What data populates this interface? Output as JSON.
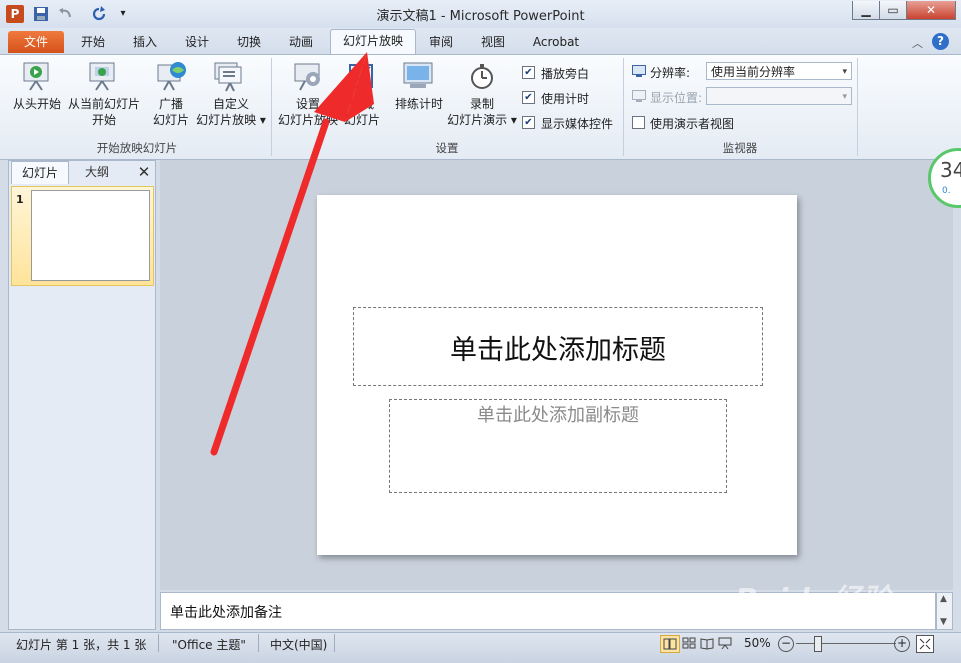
{
  "window": {
    "title": "演示文稿1 - Microsoft PowerPoint"
  },
  "tabs": [
    "文件",
    "开始",
    "插入",
    "设计",
    "切换",
    "动画",
    "幻灯片放映",
    "审阅",
    "视图",
    "Acrobat"
  ],
  "ribbon": {
    "groups": [
      {
        "label": "开始放映幻灯片",
        "buttons": [
          {
            "line1": "从头开始",
            "line2": ""
          },
          {
            "line1": "从当前幻灯片",
            "line2": "开始"
          },
          {
            "line1": "广播",
            "line2": "幻灯片"
          },
          {
            "line1": "自定义",
            "line2": "幻灯片放映 ▾"
          }
        ]
      },
      {
        "label": "设置",
        "buttons": [
          {
            "line1": "设置",
            "line2": "幻灯片放映"
          },
          {
            "line1": "隐藏",
            "line2": "幻灯片"
          },
          {
            "line1": "排练计时",
            "line2": ""
          },
          {
            "line1": "录制",
            "line2": "幻灯片演示 ▾"
          }
        ],
        "checkboxes": [
          {
            "label": "播放旁白",
            "checked": true
          },
          {
            "label": "使用计时",
            "checked": true
          },
          {
            "label": "显示媒体控件",
            "checked": true
          }
        ]
      },
      {
        "label": "监视器",
        "resolution_label": "分辨率:",
        "resolution_value": "使用当前分辨率",
        "display_label": "显示位置:",
        "display_value": "",
        "presenter_view_label": "使用演示者视图"
      }
    ]
  },
  "left_panel": {
    "tab_slides": "幻灯片",
    "tab_outline": "大纲",
    "close_glyph": "✕",
    "slide_number": "1"
  },
  "slide": {
    "title_placeholder": "单击此处添加标题",
    "subtitle_placeholder": "单击此处添加副标题"
  },
  "notes": {
    "placeholder": "单击此处添加备注"
  },
  "status": {
    "slide_info": "幻灯片 第 1 张，共 1 张",
    "theme": "\"Office 主题\"",
    "language": "中文(中国)",
    "zoom": "50%"
  },
  "overlay": {
    "badge_number": "34",
    "badge_sub": "0.",
    "watermark": "Baidu经验"
  },
  "colors": {
    "accent_file_tab": "#d4511b",
    "arrow": "#ee2a2a"
  }
}
